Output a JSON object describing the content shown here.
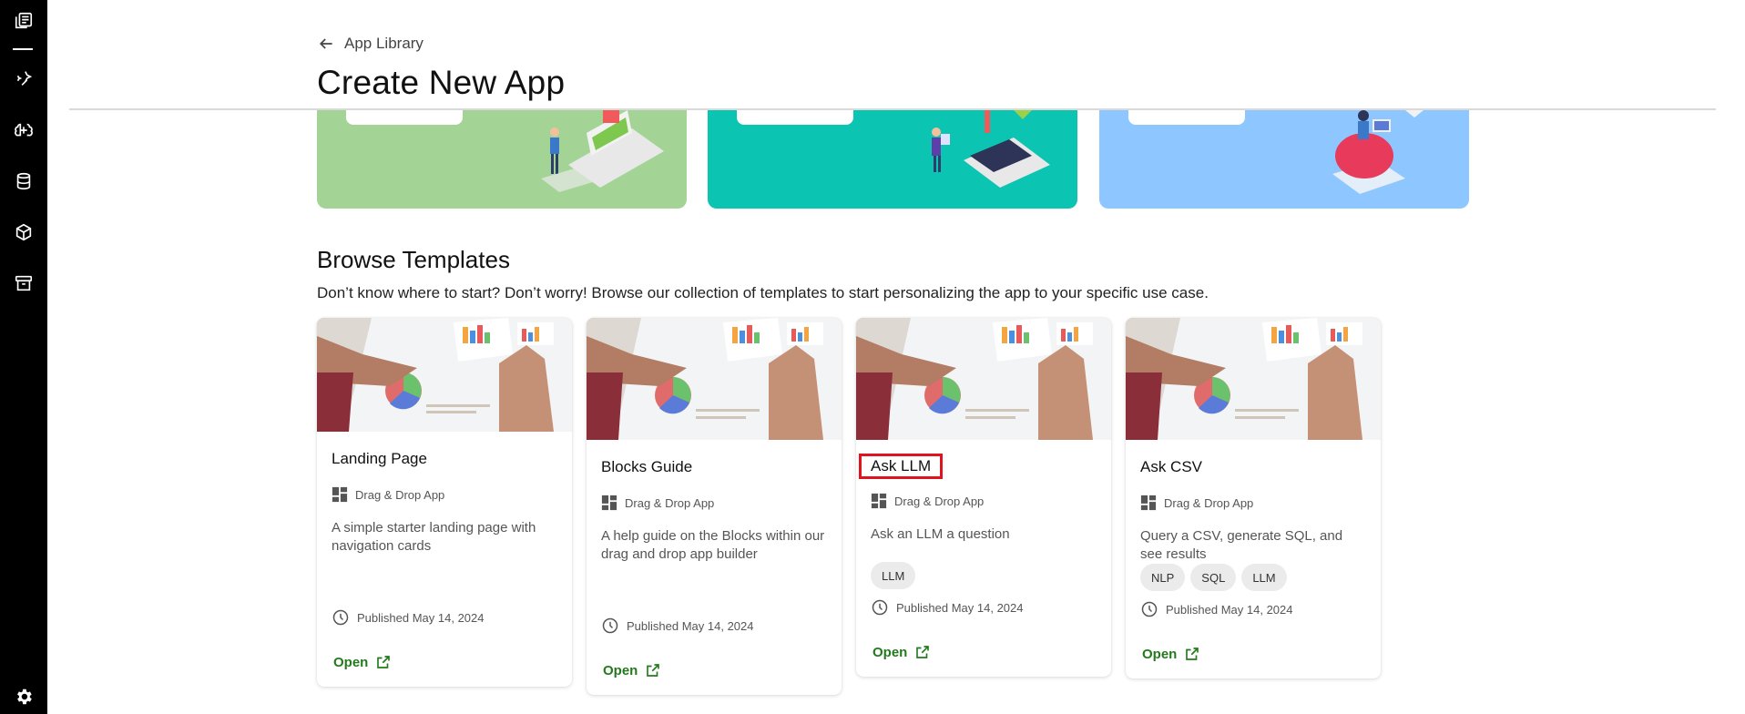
{
  "header": {
    "back_label": "App Library",
    "title": "Create New App"
  },
  "templates": {
    "title": "Browse Templates",
    "description": "Don’t know where to start? Don’t worry! Browse our collection of templates to start personalizing the app to your specific use case.",
    "cards": [
      {
        "title": "Landing Page",
        "type": "Drag & Drop App",
        "description": "A simple starter landing page with navigation cards",
        "tags": [],
        "published": "Published May 14, 2024",
        "open_label": "Open"
      },
      {
        "title": "Blocks Guide",
        "type": "Drag & Drop App",
        "description": "A help guide on the Blocks within our drag and drop app builder",
        "tags": [],
        "published": "Published May 14, 2024",
        "open_label": "Open"
      },
      {
        "title": "Ask LLM",
        "type": "Drag & Drop App",
        "description": "Ask an LLM a question",
        "tags": [
          "LLM"
        ],
        "published": "Published May 14, 2024",
        "open_label": "Open"
      },
      {
        "title": "Ask CSV",
        "type": "Drag & Drop App",
        "description": "Query a CSV, generate SQL, and see results",
        "tags": [
          "NLP",
          "SQL",
          "LLM"
        ],
        "published": "Published May 14, 2024",
        "open_label": "Open"
      }
    ]
  },
  "colors": {
    "sidebar_bg": "#000000",
    "banner_green": "#a3d496",
    "banner_teal": "#0bc4b2",
    "banner_blue": "#8ec7ff",
    "open_link": "#237a1c",
    "highlight_box": "#e0141e"
  },
  "sidebar_icons": [
    "library-icon",
    "sparkle-icon",
    "brain-icon",
    "database-icon",
    "cube-icon",
    "archive-icon",
    "settings-icon"
  ]
}
